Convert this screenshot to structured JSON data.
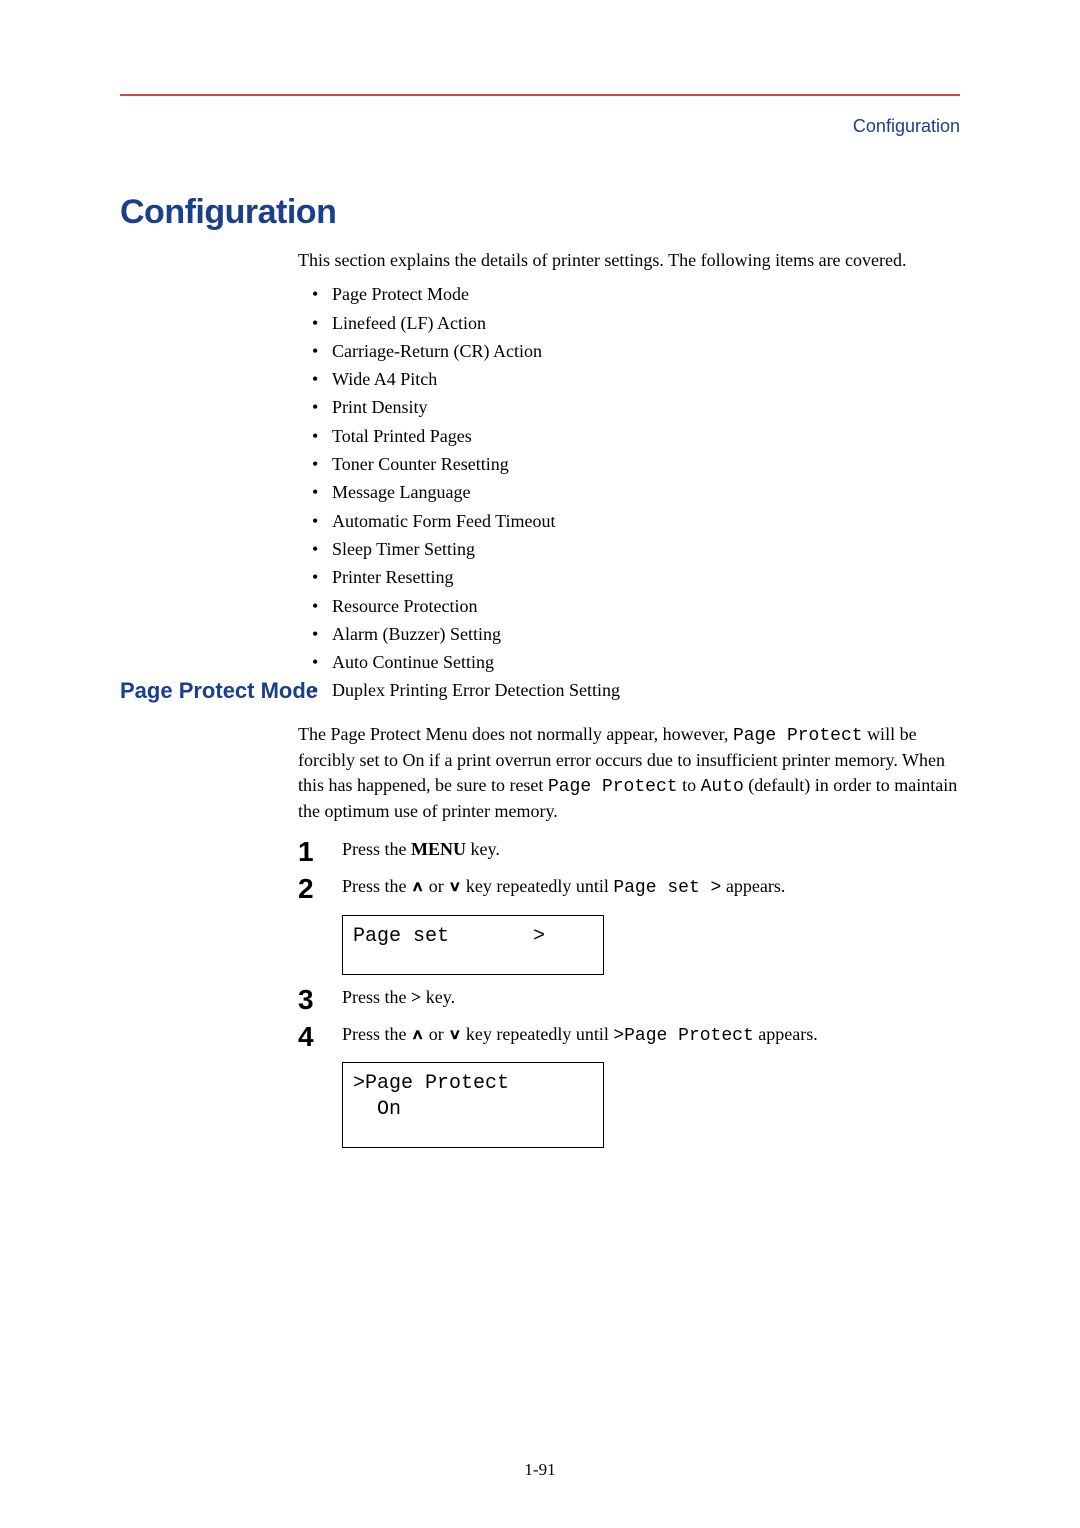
{
  "runhead": "Configuration",
  "h1": "Configuration",
  "intro": "This section explains the details of printer settings. The following items are covered.",
  "bullets": [
    "Page Protect Mode",
    "Linefeed (LF) Action",
    "Carriage-Return (CR) Action",
    "Wide A4 Pitch",
    "Print Density",
    "Total Printed Pages",
    "Toner Counter Resetting",
    "Message Language",
    "Automatic Form Feed Timeout",
    "Sleep Timer Setting",
    "Printer Resetting",
    "Resource Protection",
    "Alarm (Buzzer) Setting",
    "Auto Continue Setting",
    "Duplex Printing Error Detection Setting"
  ],
  "h2": "Page Protect Mode",
  "para2": {
    "a": "The Page Protect Menu does not normally appear, however, ",
    "mono1": "Page Protect",
    "b": " will be forcibly set to On if a print overrun error occurs due to insufficient printer memory. When this has happened, be sure to reset ",
    "mono2": "Page Protect",
    "c": " to ",
    "mono3": "Auto",
    "d": " (default) in order to maintain the optimum use of printer memory."
  },
  "steps": {
    "s1": {
      "num": "1",
      "a": "Press the ",
      "bold": "MENU",
      "b": " key."
    },
    "s2": {
      "num": "2",
      "a": "Press the ",
      "b": " or ",
      "c": " key repeatedly until ",
      "mono": "Page set >",
      "d": " appears."
    },
    "lcd1": "Page set       >",
    "s3": {
      "num": "3",
      "a": "Press the ",
      "bold": ">",
      "b": " key."
    },
    "s4": {
      "num": "4",
      "a": "Press the ",
      "b": " or ",
      "c": " key repeatedly until ",
      "mono": ">Page Protect",
      "d": " appears."
    },
    "lcd2": ">Page Protect\n  On"
  },
  "folio": "1-91"
}
